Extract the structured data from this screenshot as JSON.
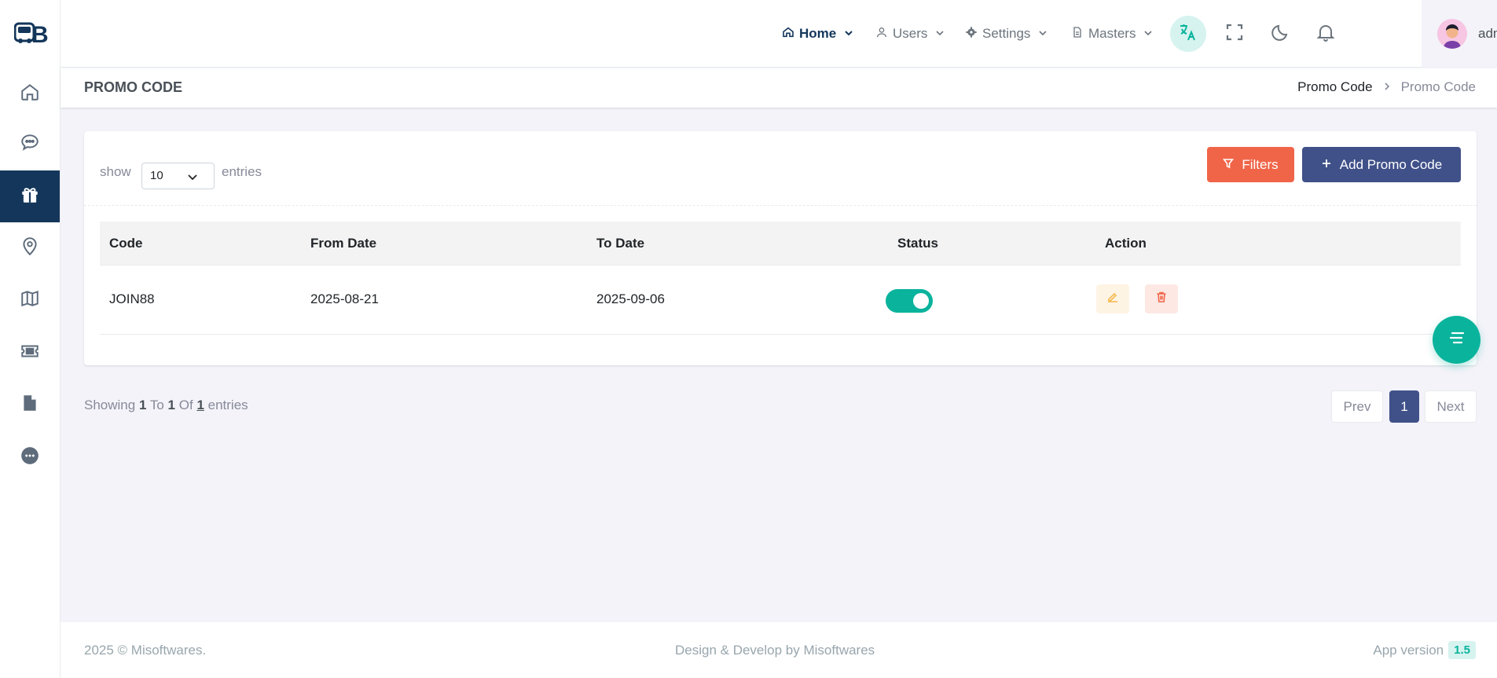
{
  "brand": {
    "logo_text": "BB"
  },
  "sidebar": {
    "items": [
      {
        "name": "home",
        "icon": "home-icon",
        "active": false
      },
      {
        "name": "chat",
        "icon": "chat-icon",
        "active": false
      },
      {
        "name": "promo",
        "icon": "gift-icon",
        "active": true
      },
      {
        "name": "location",
        "icon": "map-pin-icon",
        "active": false
      },
      {
        "name": "map",
        "icon": "map-icon",
        "active": false
      },
      {
        "name": "ticket",
        "icon": "ticket-icon",
        "active": false
      },
      {
        "name": "document",
        "icon": "file-icon",
        "active": false
      },
      {
        "name": "more",
        "icon": "more-icon",
        "active": false
      }
    ]
  },
  "topbar": {
    "nav": [
      {
        "label": "Home",
        "icon": "home-icon",
        "active": true
      },
      {
        "label": "Users",
        "icon": "user-icon",
        "active": false
      },
      {
        "label": "Settings",
        "icon": "gear-icon",
        "active": false
      },
      {
        "label": "Masters",
        "icon": "file-icon",
        "active": false
      }
    ],
    "user_name": "admin"
  },
  "page": {
    "title": "Promo Code",
    "breadcrumb": {
      "parent": "Promo Code",
      "current": "Promo Code"
    }
  },
  "toolbar": {
    "show_label": "show",
    "entries_value": "10",
    "entries_label": "entries",
    "filters_label": "Filters",
    "add_label": "Add Promo Code"
  },
  "table": {
    "columns": [
      "Code",
      "From Date",
      "To Date",
      "Status",
      "Action"
    ],
    "rows": [
      {
        "code": "JOIN88",
        "from": "2025-08-21",
        "to": "2025-09-06",
        "status_on": true
      }
    ]
  },
  "pagination": {
    "showing_prefix": "Showing",
    "from": "1",
    "to_word": "To",
    "to": "1",
    "of_word": "Of",
    "total": "1",
    "suffix": "entries",
    "prev": "Prev",
    "page": "1",
    "next": "Next"
  },
  "footer": {
    "copyright": "2025 © Misoftwares.",
    "credit": "Design & Develop by Misoftwares",
    "version_label": "App version",
    "version": "1.5"
  },
  "colors": {
    "accent": "#405189",
    "danger": "#f06548",
    "success": "#0ab39c",
    "sidebar_active": "#13365a"
  }
}
